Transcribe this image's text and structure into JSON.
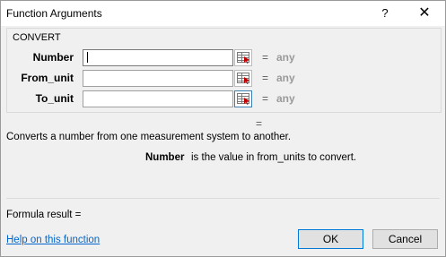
{
  "window": {
    "title": "Function Arguments",
    "help_glyph": "?",
    "close_glyph": "✕"
  },
  "group": {
    "function_name": "CONVERT",
    "args": [
      {
        "label": "Number",
        "value": "",
        "equals": "=",
        "result": "any"
      },
      {
        "label": "From_unit",
        "value": "",
        "equals": "=",
        "result": "any"
      },
      {
        "label": "To_unit",
        "value": "",
        "equals": "=",
        "result": "any"
      }
    ]
  },
  "result_equals": "=",
  "description": "Converts a number from one measurement system to another.",
  "arg_help": {
    "name": "Number",
    "text": "is the value in from_units to convert."
  },
  "formula_result_label": "Formula result =",
  "help_link": "Help on this function",
  "buttons": {
    "ok": "OK",
    "cancel": "Cancel"
  },
  "colors": {
    "link": "#0066cc",
    "focus_border": "#0078d7",
    "any_text": "#9a9a9a"
  },
  "icons": {
    "ref_button": "range-select-icon"
  }
}
